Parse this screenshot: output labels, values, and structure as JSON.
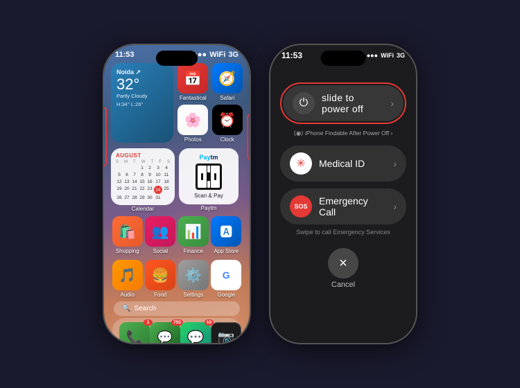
{
  "left_phone": {
    "status": {
      "time": "11:53",
      "signal": "●●●",
      "wifi": "WiFi",
      "network": "3G"
    },
    "weather_widget": {
      "city": "Noida ↗",
      "temp": "32°",
      "desc": "Partly Cloudy",
      "range": "H:34° L:26°"
    },
    "calendar": {
      "month": "AUGUST",
      "days": [
        "S",
        "M",
        "T",
        "W",
        "T",
        "F",
        "S"
      ],
      "rows": [
        [
          "",
          "",
          "",
          "1",
          "2",
          "3",
          "4",
          "5"
        ],
        [
          "6",
          "7",
          "8",
          "9",
          "10",
          "11",
          "12"
        ],
        [
          "13",
          "14",
          "15",
          "16",
          "17",
          "18",
          "19"
        ],
        [
          "20",
          "21",
          "22",
          "23",
          "24",
          "25",
          "26"
        ],
        [
          "27",
          "28",
          "29",
          "30",
          "31",
          "",
          ""
        ]
      ],
      "today": "24"
    },
    "apps_top_row": [
      {
        "label": "Fantastical",
        "emoji": "📅",
        "bg": "bg-fantastical"
      },
      {
        "label": "Safari",
        "emoji": "🧭",
        "bg": "bg-safari"
      }
    ],
    "apps_mid_row": [
      {
        "label": "Photos",
        "emoji": "📷",
        "bg": "bg-photos"
      },
      {
        "label": "Clock",
        "emoji": "⏰",
        "bg": "bg-clock"
      }
    ],
    "widgets_label_calendar": "Calendar",
    "widgets_label_paytm": "Paytm",
    "paytm": {
      "label": "Scan & Pay",
      "logo": "Paytm"
    },
    "bottom_row1": [
      {
        "label": "Shopping",
        "emoji": "🛍️",
        "bg": "bg-shopping",
        "badge": ""
      },
      {
        "label": "Social",
        "emoji": "👥",
        "bg": "bg-social",
        "badge": ""
      },
      {
        "label": "Finance",
        "emoji": "📊",
        "bg": "bg-finance",
        "badge": ""
      },
      {
        "label": "App Store",
        "emoji": "🅰️",
        "bg": "bg-appstore",
        "badge": ""
      }
    ],
    "bottom_row2": [
      {
        "label": "Audio",
        "emoji": "🎵",
        "bg": "bg-audio",
        "badge": ""
      },
      {
        "label": "Food",
        "emoji": "🍔",
        "bg": "bg-food",
        "badge": ""
      },
      {
        "label": "Settings",
        "emoji": "⚙️",
        "bg": "bg-settings",
        "badge": ""
      },
      {
        "label": "Google",
        "emoji": "G",
        "bg": "bg-google",
        "badge": ""
      }
    ],
    "search_placeholder": "Search",
    "dock": [
      {
        "label": "Phone",
        "emoji": "📞",
        "bg": "bg-phone",
        "badge": "1"
      },
      {
        "label": "Messages",
        "emoji": "💬",
        "bg": "bg-messages",
        "badge": "755"
      },
      {
        "label": "WhatsApp",
        "emoji": "💬",
        "bg": "bg-whatsapp",
        "badge": "10"
      },
      {
        "label": "Camera",
        "emoji": "📷",
        "bg": "bg-camera",
        "badge": ""
      }
    ]
  },
  "right_phone": {
    "status": {
      "time": "11:53",
      "signal": "●●●",
      "wifi": "WiFi",
      "network": "3G"
    },
    "power_slider": {
      "label": "slide to power off",
      "icon": "⏻"
    },
    "findable_text": "iPhone Findable After Power Off",
    "medical_id": {
      "label": "Medical ID",
      "icon": "*"
    },
    "emergency_call": {
      "label": "Emergency Call",
      "sos_text": "SOS"
    },
    "swipe_hint": "Swipe to call Emergency Services",
    "cancel": {
      "label": "Cancel",
      "icon": "×"
    }
  },
  "sos_label": "SOS Emergency Call"
}
